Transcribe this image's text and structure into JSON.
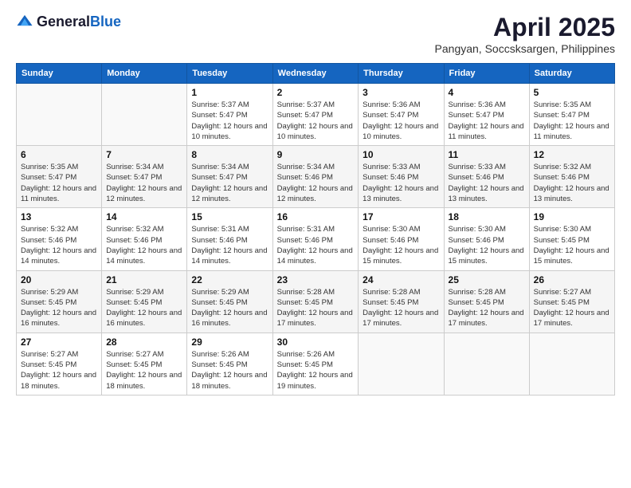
{
  "header": {
    "logo_general": "General",
    "logo_blue": "Blue",
    "month_title": "April 2025",
    "location": "Pangyan, Soccsksargen, Philippines"
  },
  "days_of_week": [
    "Sunday",
    "Monday",
    "Tuesday",
    "Wednesday",
    "Thursday",
    "Friday",
    "Saturday"
  ],
  "weeks": [
    [
      {
        "day": "",
        "sunrise": "",
        "sunset": "",
        "daylight": ""
      },
      {
        "day": "",
        "sunrise": "",
        "sunset": "",
        "daylight": ""
      },
      {
        "day": "1",
        "sunrise": "Sunrise: 5:37 AM",
        "sunset": "Sunset: 5:47 PM",
        "daylight": "Daylight: 12 hours and 10 minutes."
      },
      {
        "day": "2",
        "sunrise": "Sunrise: 5:37 AM",
        "sunset": "Sunset: 5:47 PM",
        "daylight": "Daylight: 12 hours and 10 minutes."
      },
      {
        "day": "3",
        "sunrise": "Sunrise: 5:36 AM",
        "sunset": "Sunset: 5:47 PM",
        "daylight": "Daylight: 12 hours and 10 minutes."
      },
      {
        "day": "4",
        "sunrise": "Sunrise: 5:36 AM",
        "sunset": "Sunset: 5:47 PM",
        "daylight": "Daylight: 12 hours and 11 minutes."
      },
      {
        "day": "5",
        "sunrise": "Sunrise: 5:35 AM",
        "sunset": "Sunset: 5:47 PM",
        "daylight": "Daylight: 12 hours and 11 minutes."
      }
    ],
    [
      {
        "day": "6",
        "sunrise": "Sunrise: 5:35 AM",
        "sunset": "Sunset: 5:47 PM",
        "daylight": "Daylight: 12 hours and 11 minutes."
      },
      {
        "day": "7",
        "sunrise": "Sunrise: 5:34 AM",
        "sunset": "Sunset: 5:47 PM",
        "daylight": "Daylight: 12 hours and 12 minutes."
      },
      {
        "day": "8",
        "sunrise": "Sunrise: 5:34 AM",
        "sunset": "Sunset: 5:47 PM",
        "daylight": "Daylight: 12 hours and 12 minutes."
      },
      {
        "day": "9",
        "sunrise": "Sunrise: 5:34 AM",
        "sunset": "Sunset: 5:46 PM",
        "daylight": "Daylight: 12 hours and 12 minutes."
      },
      {
        "day": "10",
        "sunrise": "Sunrise: 5:33 AM",
        "sunset": "Sunset: 5:46 PM",
        "daylight": "Daylight: 12 hours and 13 minutes."
      },
      {
        "day": "11",
        "sunrise": "Sunrise: 5:33 AM",
        "sunset": "Sunset: 5:46 PM",
        "daylight": "Daylight: 12 hours and 13 minutes."
      },
      {
        "day": "12",
        "sunrise": "Sunrise: 5:32 AM",
        "sunset": "Sunset: 5:46 PM",
        "daylight": "Daylight: 12 hours and 13 minutes."
      }
    ],
    [
      {
        "day": "13",
        "sunrise": "Sunrise: 5:32 AM",
        "sunset": "Sunset: 5:46 PM",
        "daylight": "Daylight: 12 hours and 14 minutes."
      },
      {
        "day": "14",
        "sunrise": "Sunrise: 5:32 AM",
        "sunset": "Sunset: 5:46 PM",
        "daylight": "Daylight: 12 hours and 14 minutes."
      },
      {
        "day": "15",
        "sunrise": "Sunrise: 5:31 AM",
        "sunset": "Sunset: 5:46 PM",
        "daylight": "Daylight: 12 hours and 14 minutes."
      },
      {
        "day": "16",
        "sunrise": "Sunrise: 5:31 AM",
        "sunset": "Sunset: 5:46 PM",
        "daylight": "Daylight: 12 hours and 14 minutes."
      },
      {
        "day": "17",
        "sunrise": "Sunrise: 5:30 AM",
        "sunset": "Sunset: 5:46 PM",
        "daylight": "Daylight: 12 hours and 15 minutes."
      },
      {
        "day": "18",
        "sunrise": "Sunrise: 5:30 AM",
        "sunset": "Sunset: 5:46 PM",
        "daylight": "Daylight: 12 hours and 15 minutes."
      },
      {
        "day": "19",
        "sunrise": "Sunrise: 5:30 AM",
        "sunset": "Sunset: 5:45 PM",
        "daylight": "Daylight: 12 hours and 15 minutes."
      }
    ],
    [
      {
        "day": "20",
        "sunrise": "Sunrise: 5:29 AM",
        "sunset": "Sunset: 5:45 PM",
        "daylight": "Daylight: 12 hours and 16 minutes."
      },
      {
        "day": "21",
        "sunrise": "Sunrise: 5:29 AM",
        "sunset": "Sunset: 5:45 PM",
        "daylight": "Daylight: 12 hours and 16 minutes."
      },
      {
        "day": "22",
        "sunrise": "Sunrise: 5:29 AM",
        "sunset": "Sunset: 5:45 PM",
        "daylight": "Daylight: 12 hours and 16 minutes."
      },
      {
        "day": "23",
        "sunrise": "Sunrise: 5:28 AM",
        "sunset": "Sunset: 5:45 PM",
        "daylight": "Daylight: 12 hours and 17 minutes."
      },
      {
        "day": "24",
        "sunrise": "Sunrise: 5:28 AM",
        "sunset": "Sunset: 5:45 PM",
        "daylight": "Daylight: 12 hours and 17 minutes."
      },
      {
        "day": "25",
        "sunrise": "Sunrise: 5:28 AM",
        "sunset": "Sunset: 5:45 PM",
        "daylight": "Daylight: 12 hours and 17 minutes."
      },
      {
        "day": "26",
        "sunrise": "Sunrise: 5:27 AM",
        "sunset": "Sunset: 5:45 PM",
        "daylight": "Daylight: 12 hours and 17 minutes."
      }
    ],
    [
      {
        "day": "27",
        "sunrise": "Sunrise: 5:27 AM",
        "sunset": "Sunset: 5:45 PM",
        "daylight": "Daylight: 12 hours and 18 minutes."
      },
      {
        "day": "28",
        "sunrise": "Sunrise: 5:27 AM",
        "sunset": "Sunset: 5:45 PM",
        "daylight": "Daylight: 12 hours and 18 minutes."
      },
      {
        "day": "29",
        "sunrise": "Sunrise: 5:26 AM",
        "sunset": "Sunset: 5:45 PM",
        "daylight": "Daylight: 12 hours and 18 minutes."
      },
      {
        "day": "30",
        "sunrise": "Sunrise: 5:26 AM",
        "sunset": "Sunset: 5:45 PM",
        "daylight": "Daylight: 12 hours and 19 minutes."
      },
      {
        "day": "",
        "sunrise": "",
        "sunset": "",
        "daylight": ""
      },
      {
        "day": "",
        "sunrise": "",
        "sunset": "",
        "daylight": ""
      },
      {
        "day": "",
        "sunrise": "",
        "sunset": "",
        "daylight": ""
      }
    ]
  ]
}
